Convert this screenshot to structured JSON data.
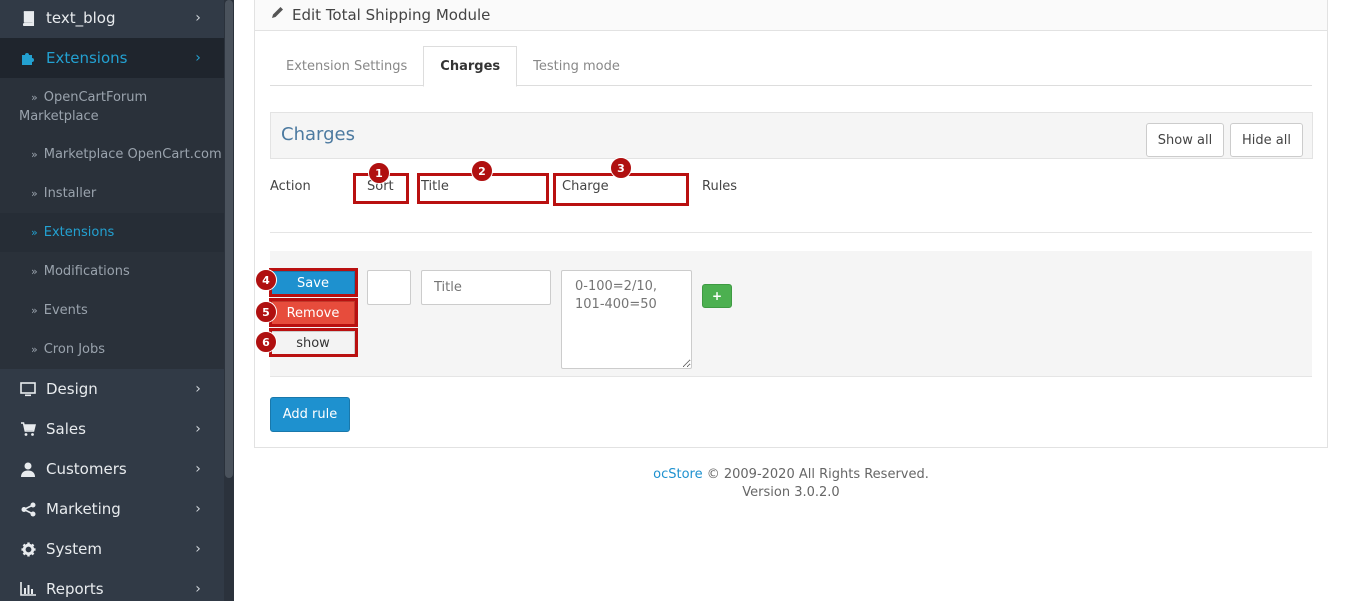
{
  "sidebar": {
    "top_items": [
      {
        "label": "text_blog",
        "icon": "book-icon"
      },
      {
        "label": "Extensions",
        "icon": "puzzle-icon"
      },
      {
        "label": "Design",
        "icon": "monitor-icon"
      },
      {
        "label": "Sales",
        "icon": "cart-icon"
      },
      {
        "label": "Customers",
        "icon": "user-icon"
      },
      {
        "label": "Marketing",
        "icon": "share-icon"
      },
      {
        "label": "System",
        "icon": "gear-icon"
      },
      {
        "label": "Reports",
        "icon": "bar-chart-icon"
      }
    ],
    "sub_items": [
      {
        "label": "OpenCartForum Marketplace"
      },
      {
        "label": "Marketplace OpenCart.com"
      },
      {
        "label": "Installer"
      },
      {
        "label": "Extensions"
      },
      {
        "label": "Modifications"
      },
      {
        "label": "Events"
      },
      {
        "label": "Cron Jobs"
      }
    ],
    "chevron": "›",
    "sub_marker": "»",
    "accent": "#23a1d1"
  },
  "panel": {
    "title": "Edit Total Shipping Module",
    "tabs": [
      {
        "label": "Extension Settings"
      },
      {
        "label": "Charges"
      },
      {
        "label": "Testing mode"
      }
    ],
    "active_tab": "Charges"
  },
  "charges": {
    "title": "Charges",
    "show_all": "Show all",
    "hide_all": "Hide all",
    "headers": {
      "action": "Action",
      "sort": "Sort",
      "title": "Title",
      "charge": "Charge",
      "rules": "Rules"
    },
    "row": {
      "save": "Save",
      "remove": "Remove",
      "show": "show",
      "sort_value": "",
      "title_placeholder": "Title",
      "charge_placeholder": "0-100=2/10,\n101-400=50",
      "plus": "+"
    },
    "add_rule": "Add rule"
  },
  "annotations": [
    "1",
    "2",
    "3",
    "4",
    "5",
    "6"
  ],
  "footer": {
    "brand": "ocStore",
    "copyright": " © 2009-2020 All Rights Reserved.",
    "version": "Version 3.0.2.0"
  },
  "colors": {
    "sidebar_bg": "#313a46",
    "primary": "#1e91cf",
    "danger": "#e74c3c",
    "success": "#4cb050",
    "highlight": "#b91010"
  }
}
